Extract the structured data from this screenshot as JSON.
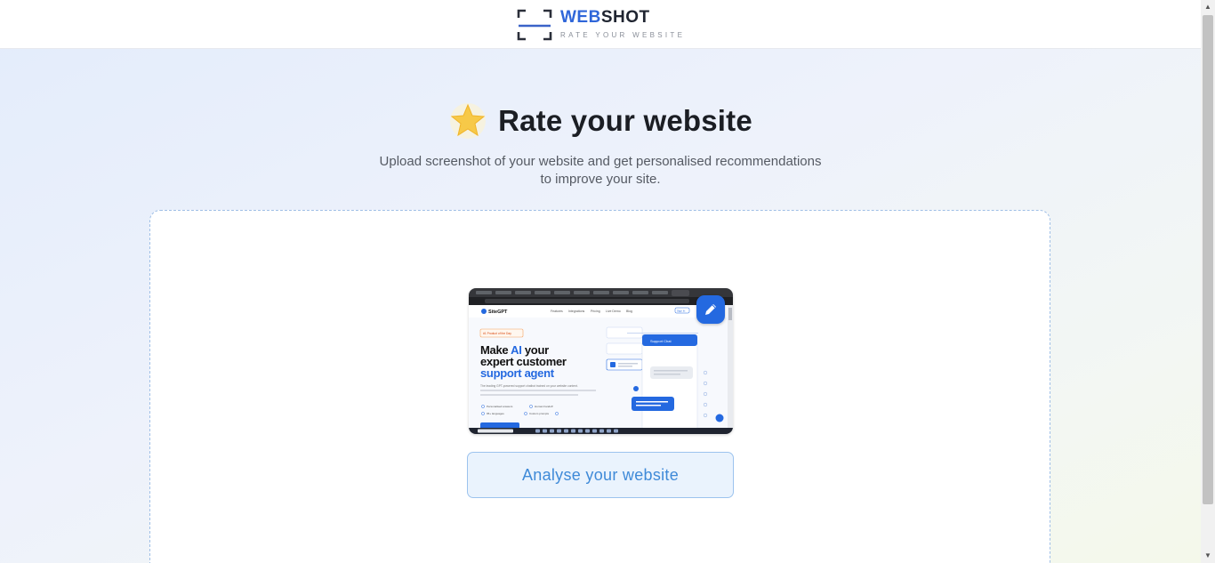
{
  "header": {
    "brand_part1": "WEB",
    "brand_part2": "SHOT",
    "tagline": "RATE YOUR WEBSITE",
    "logo_icon": "viewfinder-icon"
  },
  "hero": {
    "title": "Rate your website",
    "icon": "star-icon",
    "subtitle": "Upload screenshot of your website and get personalised recommendations to improve your site."
  },
  "upload": {
    "edit_icon": "pencil-icon",
    "analyse_label": "Analyse your website"
  },
  "preview": {
    "site_name": "SiteGPT",
    "nav_items": [
      "Features",
      "Integrations",
      "Pricing",
      "Live Demo",
      "Blog"
    ],
    "badge": "#1 Product of the Day",
    "headline_1": "Make ",
    "headline_ai": "AI",
    "headline_2": " your",
    "headline_3": "expert customer",
    "headline_4": "support agent",
    "description": "The leading GPT-powered support chatbot trained on your website content.",
    "features": [
      "Personalised answers",
      "Human handoff",
      "95+ languages",
      "Custom prompts"
    ],
    "chat_title": "Support Chat",
    "sign_in": "Sign In"
  },
  "colors": {
    "brand_blue": "#2f66d9",
    "accent_blue": "#2469e0",
    "button_text": "#3f8ad8",
    "star_yellow": "#f7c948"
  }
}
